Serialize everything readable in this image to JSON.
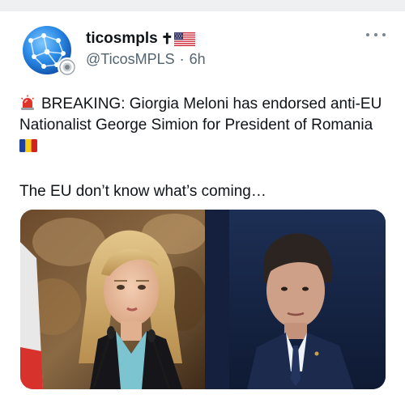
{
  "author": {
    "display_name": "ticosmpls",
    "handle": "@TicosMPLS",
    "separator": "·",
    "timestamp": "6h",
    "name_emojis": [
      "latin-cross-icon",
      "us-flag-icon"
    ]
  },
  "tweet": {
    "line1": "BREAKING: Giorgia Meloni has endorsed anti-EU",
    "line2": "Nationalist George Simion for President of Romania",
    "paragraph2": "The EU don’t know what’s coming…",
    "emojis": [
      "police-siren-icon",
      "romania-flag-icon"
    ]
  },
  "icons": {
    "more": "more-options-icon",
    "cross_glyph": "✝"
  },
  "colors": {
    "text": "#0f1419",
    "muted": "#536471",
    "top_strip": "#eef0f2"
  }
}
